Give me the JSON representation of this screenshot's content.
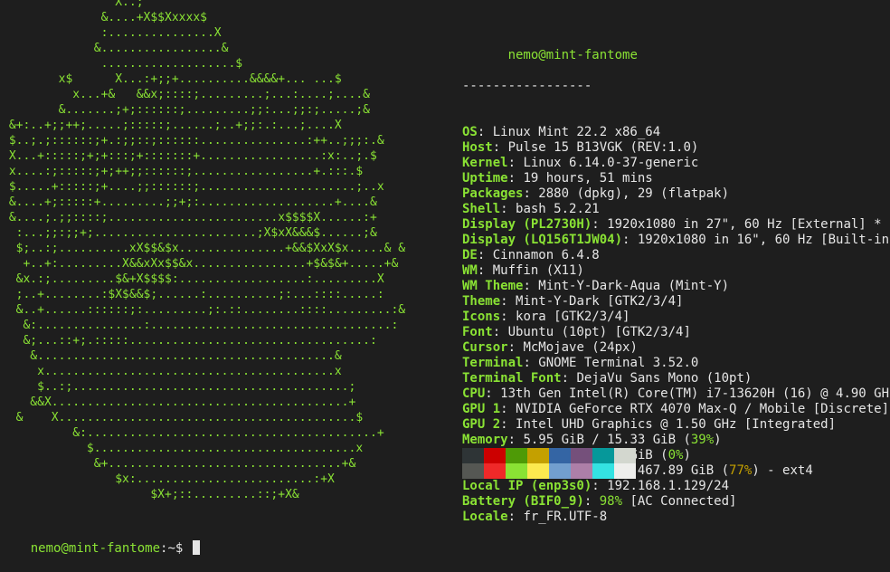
{
  "ascii_logo": "                X..;\n              &....+X$$Xxxxx$\n              :...............X\n             &.................&\n              ...................$\n        x$      X...:+;;+..........&&&&+... ...$\n          x...+&   &&x;::::;.........;...:....;....&\n        &.......;+;::::::;.........;;:...;;:;.....;&\n &+:..+;;++;.....;:::::;......;..+;;:.:...;....X\n $..;.;::::::;+.:;;::;::::::...............:++..;;;:.&\n X...+:::::;+;+:::;+:::::::+.................:x:..;.$\n x....:;:::::;+;++;;::::::;.................+.:::.$\n $.....+:::::;+....;;::::::;......................;..x\n &....+;:::::+.........;;+;:...................+....&\n &....;.;;::::;........................x$$$$X......:+\n  :...;;:;;+;.......................;X$xX&&&$......;&\n  $;..:;..........xX$$&$x...............+&&$XxX$x.....& &\n   +..+:.........X&&xXx$$&x................+$&$&+.....+&\n  &x.:;.........$&+X$$$$:..................:.........X\n  ;..+........:$X$&&$;......:..........;:...::::.....:\n  &..+......::::::;:.........;:.::........::::.........:&\n   &:...............:..................................:\n   &;...::+;.:::::..................................:\n    &..........................................&\n     x.........................................x\n     $..:;.......................................;\n    &&X..........................................+\n  &    X..........................................$\n          &:.........................................+\n            $.....................................x\n             &+.................................+&\n                $x:.........................:+X\n                     $X+;::.........::;+X&",
  "user_host": "nemo@mint-fantome",
  "separator": "-----------------",
  "info": [
    {
      "key": "OS",
      "sep": ": ",
      "value": "Linux Mint 22.2 x86_64"
    },
    {
      "key": "Host",
      "sep": ": ",
      "value": "Pulse 15 B13VGK (REV:1.0)"
    },
    {
      "key": "Kernel",
      "sep": ": ",
      "value": "Linux 6.14.0-37-generic"
    },
    {
      "key": "Uptime",
      "sep": ": ",
      "value": "19 hours, 51 mins"
    },
    {
      "key": "Packages",
      "sep": ": ",
      "value": "2880 (dpkg), 29 (flatpak)"
    },
    {
      "key": "Shell",
      "sep": ": ",
      "value": "bash 5.2.21"
    },
    {
      "key": "Display (PL2730H)",
      "sep": ": ",
      "value": "1920x1080 in 27\", 60 Hz [External] *"
    },
    {
      "key": "Display (LQ156T1JW04)",
      "sep": ": ",
      "value": "1920x1080 in 16\", 60 Hz [Built-in]"
    },
    {
      "key": "DE",
      "sep": ": ",
      "value": "Cinnamon 6.4.8"
    },
    {
      "key": "WM",
      "sep": ": ",
      "value": "Muffin (X11)"
    },
    {
      "key": "WM Theme",
      "sep": ": ",
      "value": "Mint-Y-Dark-Aqua (Mint-Y)"
    },
    {
      "key": "Theme",
      "sep": ": ",
      "value": "Mint-Y-Dark [GTK2/3/4]"
    },
    {
      "key": "Icons",
      "sep": ": ",
      "value": "kora [GTK2/3/4]"
    },
    {
      "key": "Font",
      "sep": ": ",
      "value": "Ubuntu (10pt) [GTK2/3/4]"
    },
    {
      "key": "Cursor",
      "sep": ": ",
      "value": "McMojave (24px)"
    },
    {
      "key": "Terminal",
      "sep": ": ",
      "value": "GNOME Terminal 3.52.0"
    },
    {
      "key": "Terminal Font",
      "sep": ": ",
      "value": "DejaVu Sans Mono (10pt)"
    },
    {
      "key": "CPU",
      "sep": ": ",
      "value": "13th Gen Intel(R) Core(TM) i7-13620H (16) @ 4.90 GHz"
    },
    {
      "key": "GPU 1",
      "sep": ": ",
      "value": "NVIDIA GeForce RTX 4070 Max-Q / Mobile [Discrete]"
    },
    {
      "key": "GPU 2",
      "sep": ": ",
      "value": "Intel UHD Graphics @ 1.50 GHz [Integrated]"
    },
    {
      "key": "Memory",
      "sep": ": ",
      "value": "5.95 GiB / 15.33 GiB (",
      "pct": "39%",
      "after": ")"
    },
    {
      "key": "Swap",
      "sep": ": ",
      "value": "1.61 MiB / 2.00 GiB (",
      "pct": "0%",
      "after": ")"
    },
    {
      "key": "Disk (/)",
      "sep": ": ",
      "value": "358.35 GiB / 467.89 GiB (",
      "pct": "77%",
      "pct_color": "#c4a000",
      "after": ") - ext4"
    },
    {
      "key": "Local IP (enp3s0)",
      "sep": ": ",
      "value": "192.168.1.129/24"
    },
    {
      "key": "Battery (BIF0_9)",
      "sep": ": ",
      "value": "",
      "pct": "98%",
      "after": " [AC Connected]"
    },
    {
      "key": "Locale",
      "sep": ": ",
      "value": "fr_FR.UTF-8"
    }
  ],
  "palette": {
    "normal": [
      "#2e3436",
      "#cc0000",
      "#4e9a06",
      "#c4a000",
      "#3465a4",
      "#75507b",
      "#06989a",
      "#d3d7cf"
    ],
    "bright": [
      "#555753",
      "#ef2929",
      "#8ae234",
      "#fce94f",
      "#729fcf",
      "#ad7fa8",
      "#34e2e2",
      "#eeeeec"
    ]
  },
  "prompt": {
    "user_host": "nemo@mint-fantome",
    "path": ":~$ "
  },
  "colors": {
    "accent": "#8ae234",
    "text": "#e6e6e6",
    "background": "#1e1e1e"
  }
}
